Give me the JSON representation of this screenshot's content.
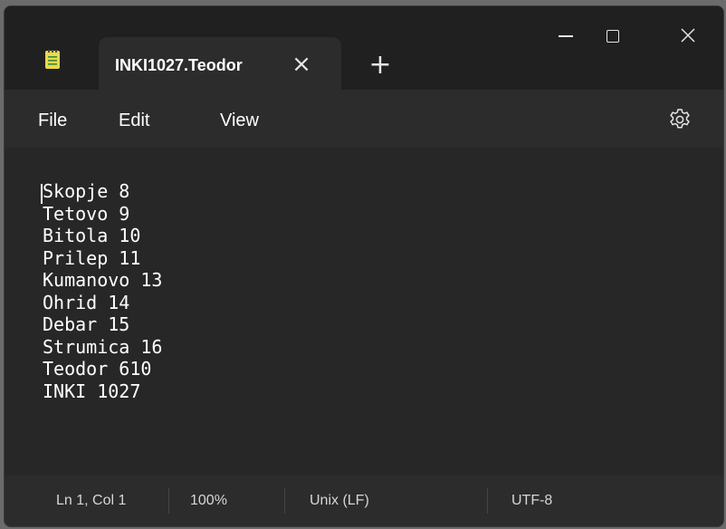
{
  "window": {
    "tab_title": "INKI1027.Teodor",
    "tab_close_glyph": "×",
    "new_tab_glyph": "+",
    "app_icon": "notepad-icon",
    "controls": [
      "minimize-icon",
      "maximize-icon",
      "close-icon"
    ]
  },
  "menu": {
    "file": "File",
    "edit": "Edit",
    "view": "View",
    "settings_icon": "gear-icon"
  },
  "editor": {
    "lines": [
      "Skopje 8",
      "Tetovo 9",
      "Bitola 10",
      "Prilep 11",
      "Kumanovo 13",
      "Ohrid 14",
      "Debar 15",
      "Strumica 16",
      "Teodor 610",
      "INKI 1027"
    ]
  },
  "status": {
    "position": "Ln 1, Col 1",
    "zoom": "100%",
    "line_ending": "Unix (LF)",
    "encoding": "UTF-8"
  },
  "colors": {
    "titlebar": "#202020",
    "tab": "#2c2c2c",
    "editor_bg": "#272727",
    "text": "#ffffff",
    "notepad_icon": "#ecd84a"
  }
}
